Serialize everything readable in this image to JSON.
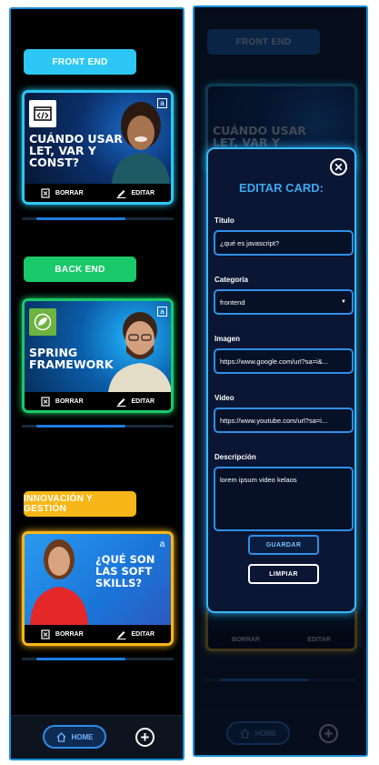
{
  "home": {
    "categories": {
      "front": {
        "label": "FRONT END",
        "color": "#2dc7f5"
      },
      "back": {
        "label": "BACK END",
        "color": "#19c96a"
      },
      "innovation": {
        "label": "INNOVACIÓN Y GESTIÓN",
        "color": "#f7b718"
      }
    },
    "cards": [
      {
        "title_lines": [
          "CUÁNDO USAR",
          "LET, VAR Y",
          "CONST?"
        ],
        "logo_icon": "code-icon",
        "delete_label": "BORRAR",
        "edit_label": "EDITAR"
      },
      {
        "title_lines": [
          "SPRING",
          "FRAMEWORK"
        ],
        "logo_icon": "spring-leaf-icon",
        "delete_label": "BORRAR",
        "edit_label": "EDITAR"
      },
      {
        "title_lines": [
          "¿QUÉ SON",
          "LAS SOFT",
          "SKILLS?"
        ],
        "logo_icon": "alura-icon",
        "delete_label": "BORRAR",
        "edit_label": "EDITAR"
      }
    ],
    "nav": {
      "home_label": "HOME",
      "home_icon": "home-icon",
      "add_icon": "plus-circle-icon"
    }
  },
  "modal": {
    "title": "EDITAR CARD:",
    "close_icon": "close-circle-icon",
    "fields": {
      "title": {
        "label": "Título",
        "value": "¿qué es javascript?"
      },
      "category": {
        "label": "Categoría",
        "value": "frontend"
      },
      "image": {
        "label": "Imagen",
        "value": "https://www.google.com/url?sa=i&..."
      },
      "video": {
        "label": "Video",
        "value": "https://www.youtube.com/url?sa=i..."
      },
      "description": {
        "label": "Descripción",
        "value": "lorem ipsum video kelaos"
      }
    },
    "save_label": "GUARDAR",
    "clear_label": "LIMPIAR"
  },
  "colors": {
    "accent": "#2f8fe8",
    "background": "#000000",
    "modal_bg": "#0a1633"
  }
}
